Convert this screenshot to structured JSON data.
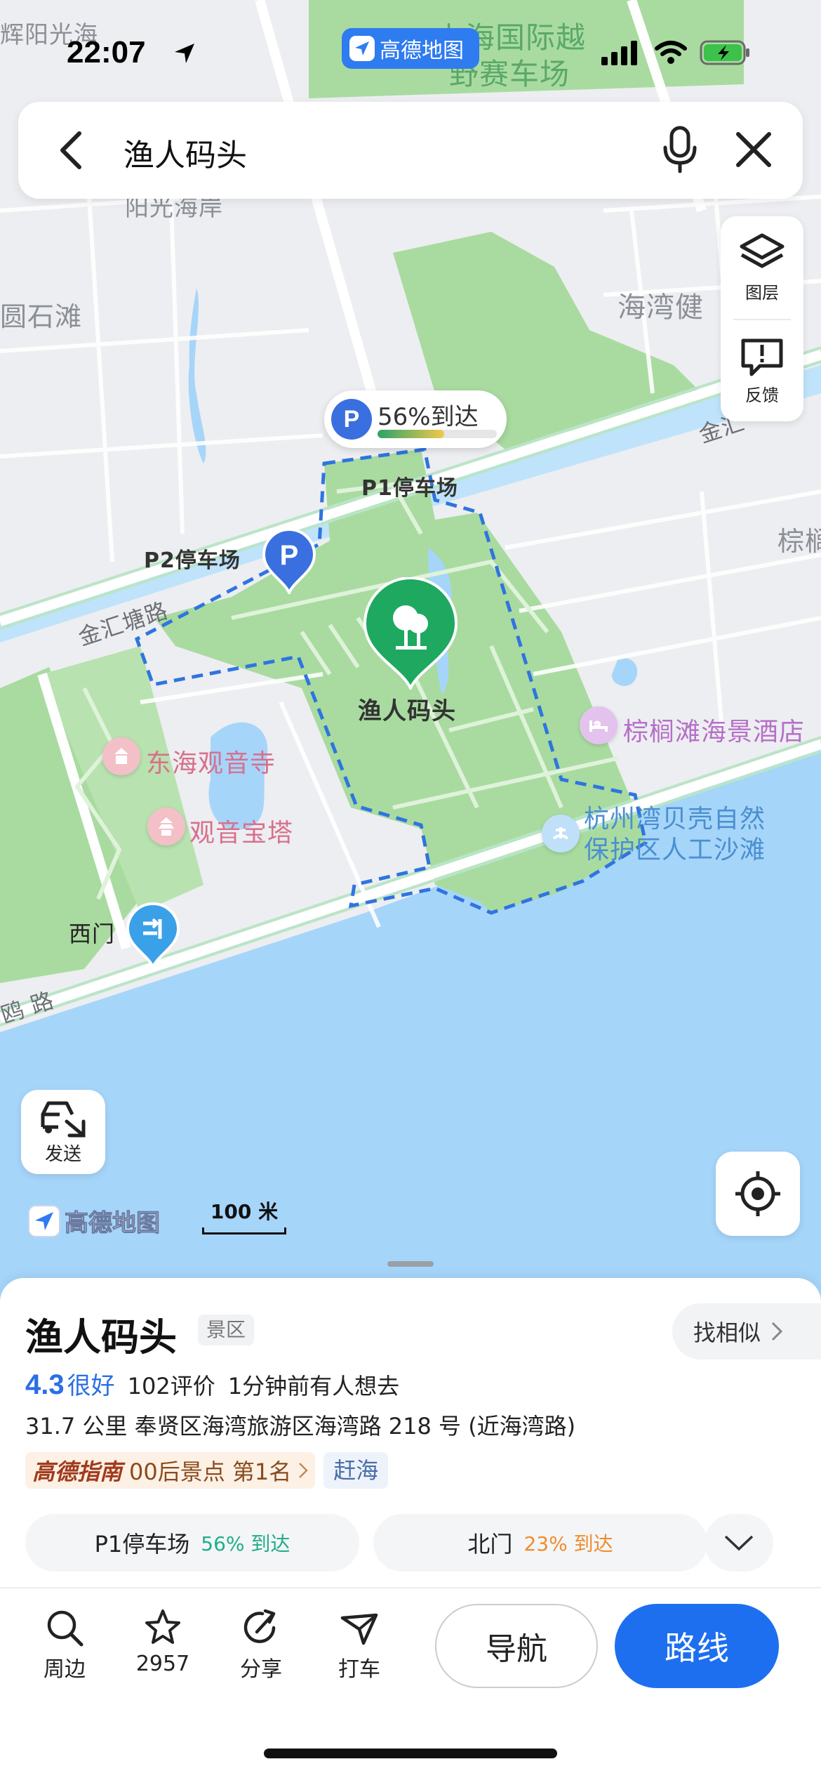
{
  "status_bar": {
    "time": "22:07",
    "app_badge": "高德地图"
  },
  "search": {
    "query": "渔人码头"
  },
  "map": {
    "labels": {
      "huiyang": "辉阳光海",
      "intl": "上海国际越",
      "intl2": "野赛车场",
      "yangguang": "阳光海岸",
      "yuanshitan": "圆石滩",
      "haiwanjian": "海湾健",
      "jinhui_e": "金汇",
      "zong": "棕榈",
      "p1": "P1停车场",
      "p2": "P2停车场",
      "jinhuitang": "金汇塘路",
      "donghai": "东海观音寺",
      "guanyin": "观音宝塔",
      "hotel": "棕榈滩海景酒店",
      "beach1": "杭州湾贝壳自然",
      "beach2": "保护区人工沙滩",
      "ximen": "西门",
      "ou": "鸥 路",
      "poi": "渔人码头"
    },
    "parking_bubble": {
      "text": "56%到达",
      "fill_fraction": 0.56
    },
    "tools": {
      "layers": "图层",
      "feedback": "反馈"
    },
    "send_label": "发送",
    "watermark": "高德地图",
    "scale": "100 米"
  },
  "place": {
    "name": "渔人码头",
    "category": "景区",
    "similar": "找相似",
    "score": "4.3",
    "score_label": "很好",
    "reviews": "102评价",
    "wanted": "1分钟前有人想去",
    "address": "31.7 公里  奉贤区海湾旅游区海湾路 218 号 (近海湾路)",
    "guide_brand": "高德指南",
    "guide_rank": "00后景点 第1名",
    "chip": "赶海",
    "entrances": [
      {
        "name": "P1停车场",
        "pct": "56% 到达",
        "color": "#1fae8a"
      },
      {
        "name": "北门",
        "pct": "23% 到达",
        "color": "#f08c2e"
      }
    ]
  },
  "actions": {
    "nearby": "周边",
    "favorites": "2957",
    "share": "分享",
    "taxi": "打车",
    "navigate": "导航",
    "route": "路线"
  },
  "colors": {
    "accent": "#1e6ff0",
    "park_green": "#a9dba0",
    "water": "#9fd0f8"
  }
}
